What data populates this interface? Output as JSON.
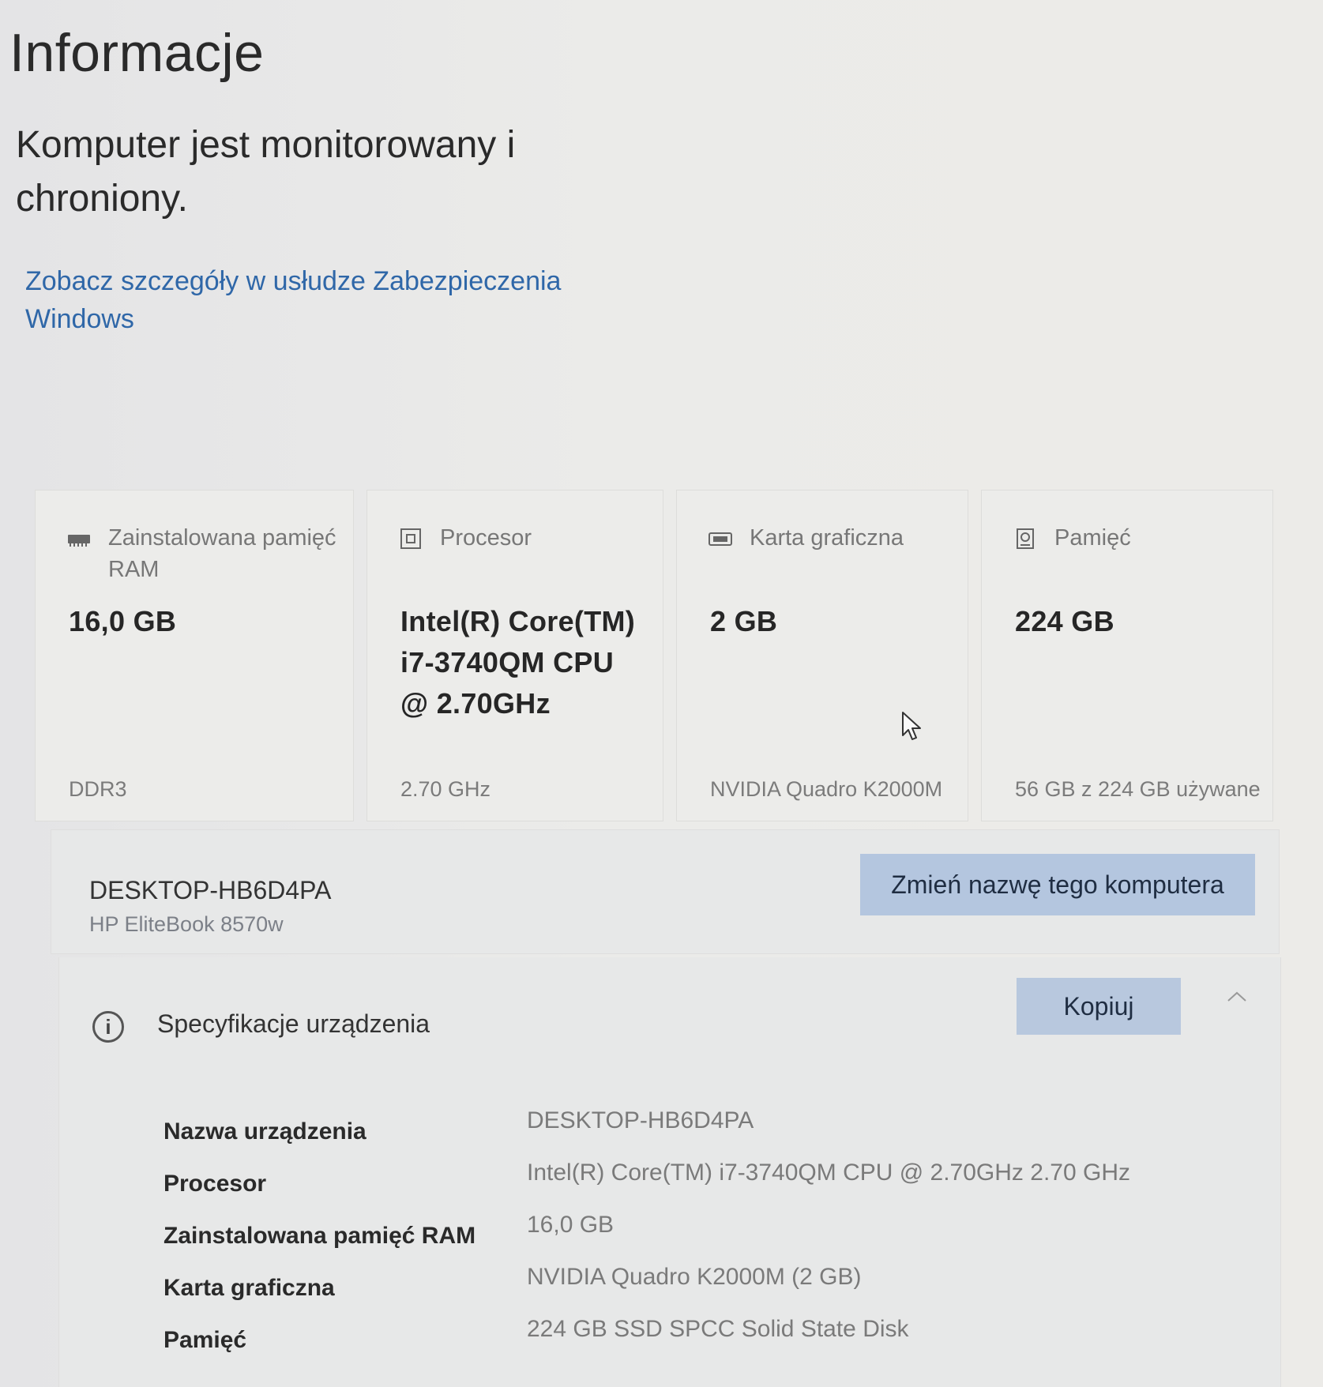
{
  "header": {
    "title": "Informacje",
    "status": "Komputer jest monitorowany i chroniony.",
    "security_link": "Zobacz szczegóły w usłudze Zabezpieczenia Windows"
  },
  "cards": {
    "ram": {
      "icon": "ram-icon",
      "title": "Zainstalowana pamięć RAM",
      "value": "16,0 GB",
      "footer": "DDR3"
    },
    "cpu": {
      "icon": "processor-icon",
      "title": "Procesor",
      "value": "Intel(R) Core(TM) i7-3740QM CPU @ 2.70GHz",
      "footer": "2.70 GHz"
    },
    "gpu": {
      "icon": "graphics-card-icon",
      "title": "Karta graficzna",
      "value": "2 GB",
      "footer": "NVIDIA Quadro K2000M"
    },
    "storage": {
      "icon": "storage-icon",
      "title": "Pamięć",
      "value": "224 GB",
      "footer": "56 GB z 224 GB używane"
    }
  },
  "device": {
    "name": "DESKTOP-HB6D4PA",
    "model": "HP EliteBook 8570w",
    "rename_button": "Zmień nazwę tego komputera"
  },
  "specifications": {
    "title": "Specyfikacje urządzenia",
    "copy_button": "Kopiuj",
    "rows": [
      {
        "label": "Nazwa urządzenia",
        "value": "DESKTOP-HB6D4PA"
      },
      {
        "label": "Procesor",
        "value": "Intel(R) Core(TM) i7-3740QM CPU @ 2.70GHz   2.70 GHz"
      },
      {
        "label": "Zainstalowana pamięć RAM",
        "value": "16,0 GB"
      },
      {
        "label": "Karta graficzna",
        "value": "NVIDIA Quadro K2000M (2 GB)"
      },
      {
        "label": "Pamięć",
        "value": "224 GB SSD SPCC Solid State Disk"
      }
    ]
  },
  "colors": {
    "background": "#ecebe8",
    "link": "#2f67a8",
    "button": "#b4c6df",
    "card_border": "#dddddb",
    "text_primary": "#262626",
    "text_secondary": "#7a7a7a"
  }
}
